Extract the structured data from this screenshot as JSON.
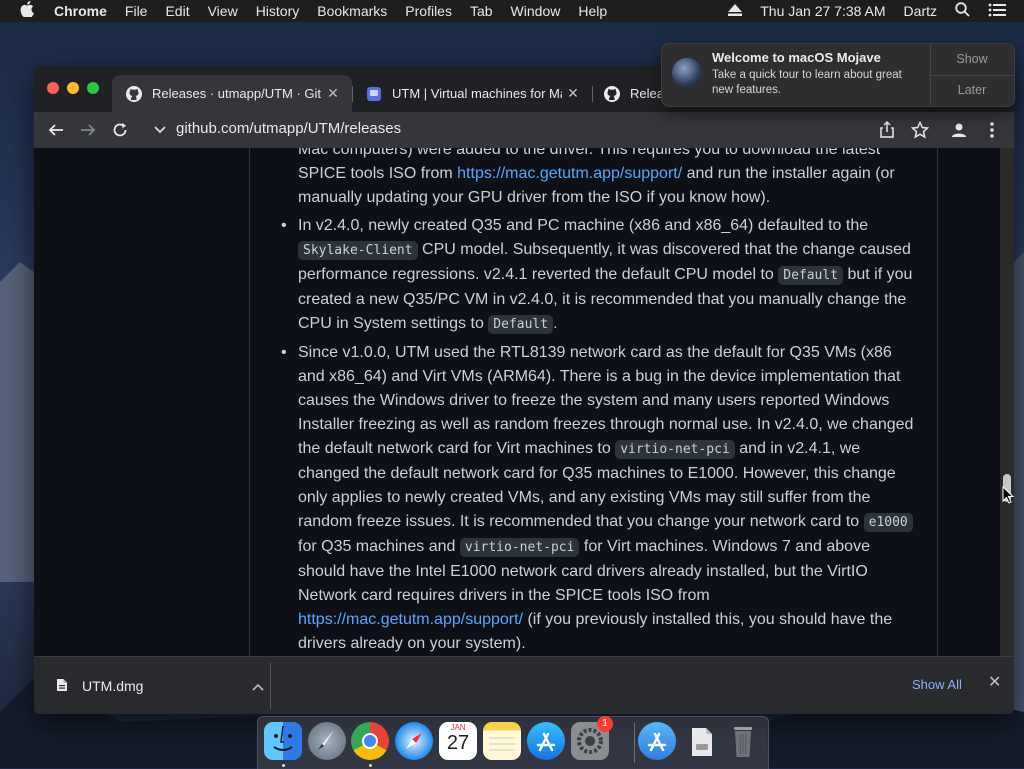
{
  "menubar": {
    "app": "Chrome",
    "items": [
      "File",
      "Edit",
      "View",
      "History",
      "Bookmarks",
      "Profiles",
      "Tab",
      "Window",
      "Help"
    ],
    "clock": "Thu Jan 27  7:38 AM",
    "user": "Dartz"
  },
  "tabs": [
    {
      "title": "Releases · utmapp/UTM · GitHub",
      "active": true
    },
    {
      "title": "UTM | Virtual machines for Mac",
      "active": false
    },
    {
      "title": "Releases",
      "active": false
    }
  ],
  "toolbar": {
    "url": "github.com/utmapp/UTM/releases"
  },
  "notification": {
    "title": "Welcome to macOS Mojave",
    "body": "Take a quick tour to learn about great new features.",
    "show": "Show",
    "later": "Later"
  },
  "article": {
    "intro": [
      "Mac computers) were added to the driver. This requires you to download the latest SPICE tools ISO from ",
      "https://mac.getutm.app/support/",
      " and run the installer again (or manually updating your GPU driver from the ISO if you know how)."
    ],
    "item1": {
      "t1": "In v2.4.0, newly created Q35 and PC machine (x86 and x86_64) defaulted to the ",
      "c1": "Skylake-Client",
      "t2": " CPU model. Subsequently, it was discovered that the change caused performance regressions. v2.4.1 reverted the default CPU model to ",
      "c2": "Default",
      "t3": " but if you created a new Q35/PC VM in v2.4.0, it is recommended that you manually change the CPU in System settings to ",
      "c3": "Default",
      "t4": "."
    },
    "item2": {
      "t1": "Since v1.0.0, UTM used the RTL8139 network card as the default for Q35 VMs (x86 and x86_64) and Virt VMs (ARM64). There is a bug in the device implementation that causes the Windows driver to freeze the system and many users reported Windows Installer freezing as well as random freezes through normal use. In v2.4.0, we changed the default network card for Virt machines to ",
      "c1": "virtio-net-pci",
      "t2": " and in v2.4.1, we changed the default network card for Q35 machines to E1000. However, this change only applies to newly created VMs, and any existing VMs may still suffer from the random freeze issues. It is recommended that you change your network card to ",
      "c2": "e1000",
      "t3": " for Q35 machines and ",
      "c3": "virtio-net-pci",
      "t4": " for Virt machines. Windows 7 and above should have the Intel E1000 network card drivers already installed, but the VirtIO Network card requires drivers in the SPICE tools ISO from ",
      "link": "https://mac.getutm.app/support/",
      "t5": " (if you previously installed this, you should have the drivers already on your system)."
    }
  },
  "downloads": {
    "file": "UTM.dmg",
    "show_all": "Show All"
  },
  "dock": {
    "calendar_month": "JAN",
    "calendar_day": "27",
    "badge": "1"
  }
}
